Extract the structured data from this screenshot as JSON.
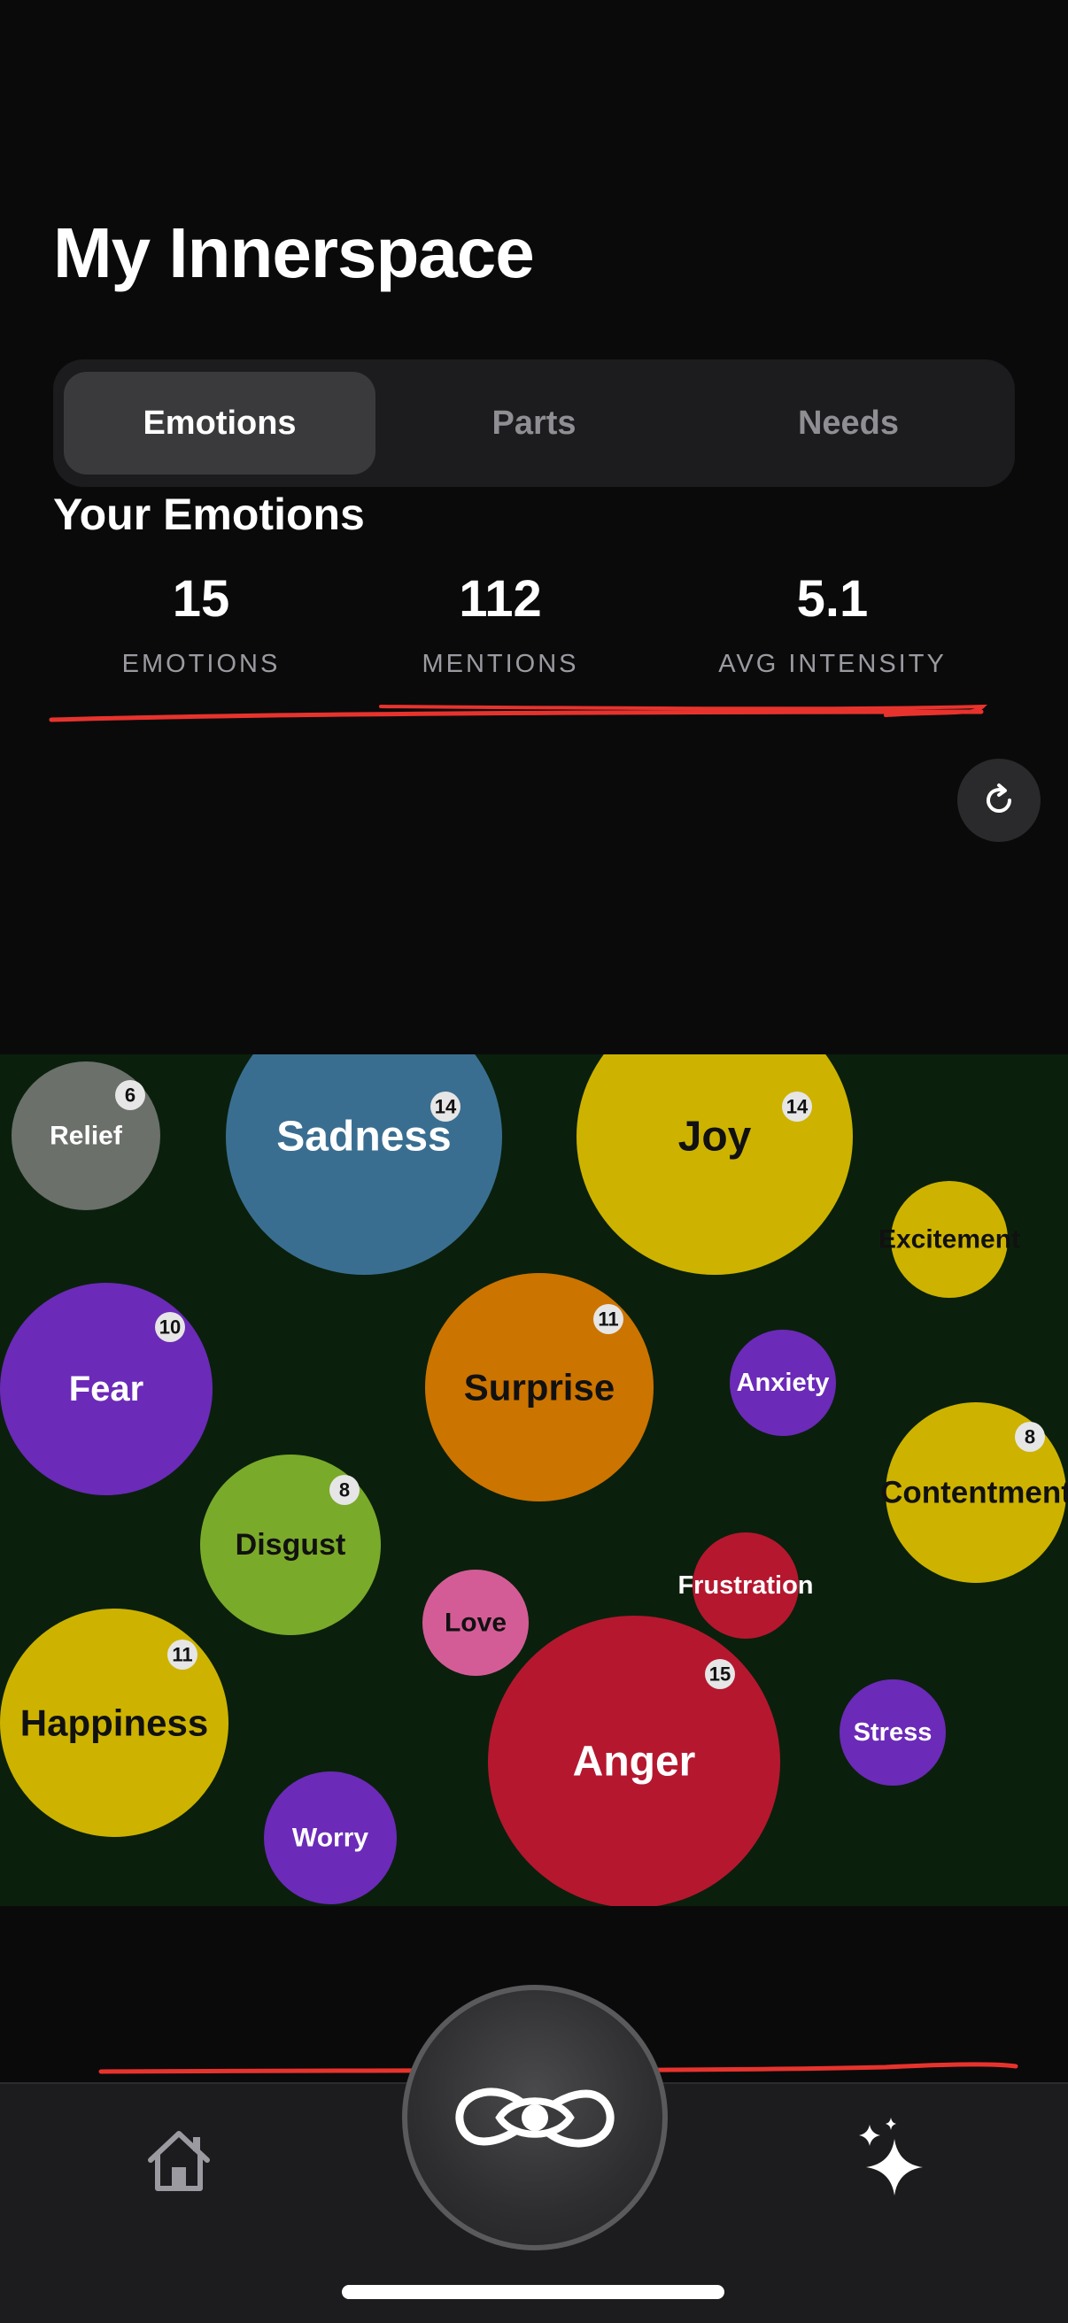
{
  "header": {
    "title": "My Innerspace"
  },
  "tabs": [
    {
      "label": "Emotions",
      "active": true
    },
    {
      "label": "Parts",
      "active": false
    },
    {
      "label": "Needs",
      "active": false
    }
  ],
  "section": {
    "title": "Your Emotions"
  },
  "stats": [
    {
      "value": "15",
      "label": "EMOTIONS"
    },
    {
      "value": "112",
      "label": "MENTIONS"
    },
    {
      "value": "5.1",
      "label": "AVG INTENSITY"
    }
  ],
  "refresh_icon": "refresh-icon",
  "colors": {
    "background": "#0a0a0b",
    "bubble_area": "#0a200c",
    "annotation_stroke": "#e8332d",
    "sadness": "#3a6e91",
    "joy": "#cdb300",
    "fear": "#6b2ab8",
    "surprise": "#cc7400",
    "disgust": "#7aaa2a",
    "love": "#d45c96",
    "anger": "#b5172f",
    "relief": "#6b706b"
  },
  "emotions": [
    {
      "name": "Relief",
      "count": "6",
      "color": "#6b706b",
      "text_color": "#ffffff"
    },
    {
      "name": "Sadness",
      "count": "14",
      "color": "#3a6e91",
      "text_color": "#ffffff"
    },
    {
      "name": "Joy",
      "count": "14",
      "color": "#cdb300",
      "text_color": "#111111"
    },
    {
      "name": "Excitement",
      "count": "",
      "color": "#cdb300",
      "text_color": "#111111"
    },
    {
      "name": "Fear",
      "count": "10",
      "color": "#6b2ab8",
      "text_color": "#ffffff"
    },
    {
      "name": "Surprise",
      "count": "11",
      "color": "#cc7400",
      "text_color": "#111111"
    },
    {
      "name": "Anxiety",
      "count": "",
      "color": "#6b2ab8",
      "text_color": "#ffffff"
    },
    {
      "name": "Contentment",
      "count": "8",
      "color": "#cdb300",
      "text_color": "#111111"
    },
    {
      "name": "Disgust",
      "count": "8",
      "color": "#7aaa2a",
      "text_color": "#111111"
    },
    {
      "name": "Frustration",
      "count": "",
      "color": "#b5172f",
      "text_color": "#ffffff"
    },
    {
      "name": "Love",
      "count": "",
      "color": "#d45c96",
      "text_color": "#111111"
    },
    {
      "name": "Happiness",
      "count": "11",
      "color": "#cdb300",
      "text_color": "#111111"
    },
    {
      "name": "Anger",
      "count": "15",
      "color": "#b5172f",
      "text_color": "#ffffff"
    },
    {
      "name": "Stress",
      "count": "",
      "color": "#6b2ab8",
      "text_color": "#ffffff"
    },
    {
      "name": "Worry",
      "count": "",
      "color": "#6b2ab8",
      "text_color": "#ffffff"
    }
  ],
  "tabbar": {
    "home_icon": "home-icon",
    "center_icon": "infinity-eye-icon",
    "sparkle_icon": "sparkles-icon"
  }
}
